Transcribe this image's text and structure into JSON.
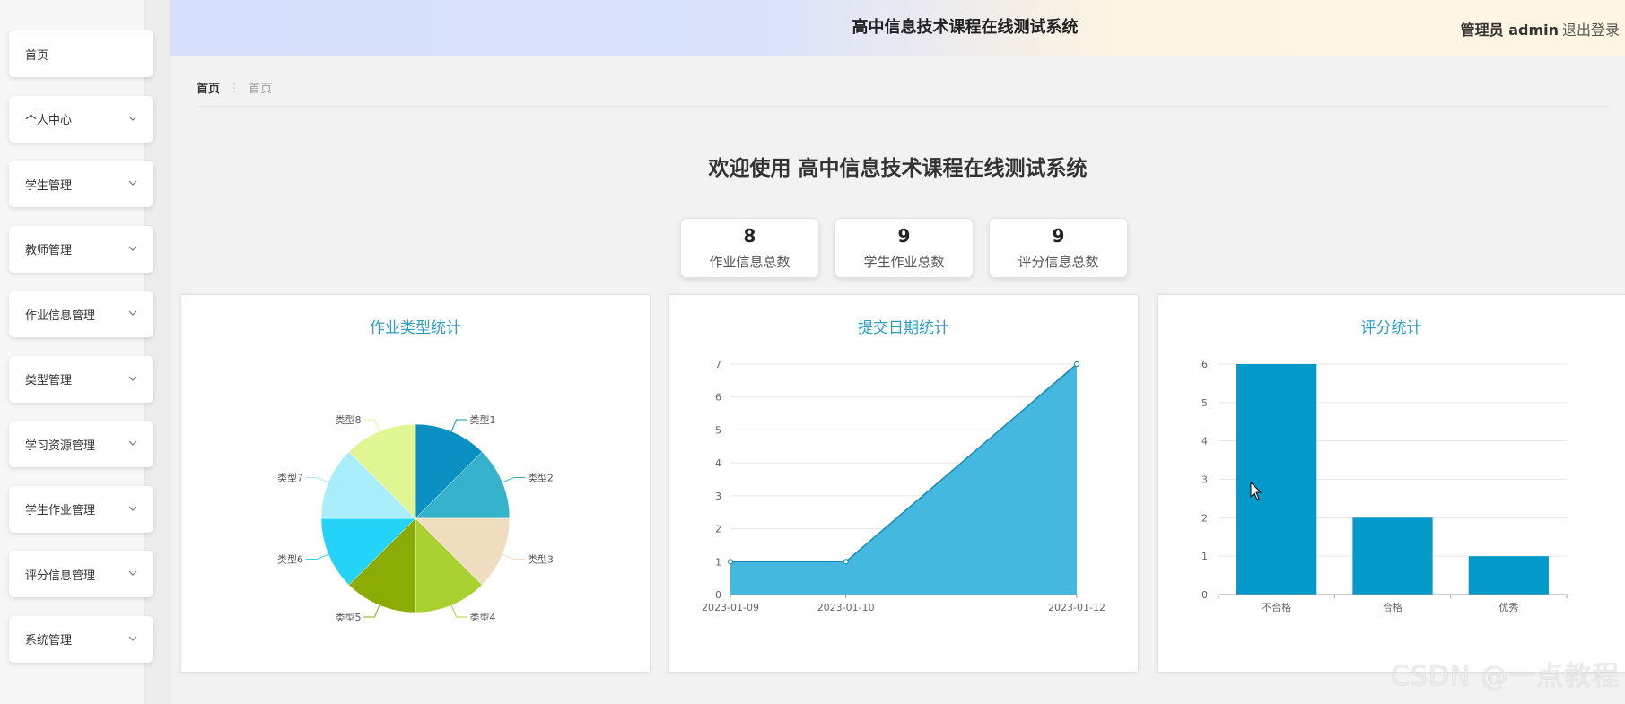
{
  "header": {
    "title": "高中信息技术课程在线测试系统",
    "user": "管理员 admin",
    "logout": "退出登录"
  },
  "sidebar": {
    "items": [
      {
        "label": "首页",
        "has_children": false
      },
      {
        "label": "个人中心",
        "has_children": true
      },
      {
        "label": "学生管理",
        "has_children": true
      },
      {
        "label": "教师管理",
        "has_children": true
      },
      {
        "label": "作业信息管理",
        "has_children": true
      },
      {
        "label": "类型管理",
        "has_children": true
      },
      {
        "label": "学习资源管理",
        "has_children": true
      },
      {
        "label": "学生作业管理",
        "has_children": true
      },
      {
        "label": "评分信息管理",
        "has_children": true
      },
      {
        "label": "系统管理",
        "has_children": true
      }
    ]
  },
  "breadcrumb": {
    "home": "首页",
    "current": "首页"
  },
  "welcome": "欢迎使用 高中信息技术课程在线测试系统",
  "stats": [
    {
      "value": "8",
      "label": "作业信息总数"
    },
    {
      "value": "9",
      "label": "学生作业总数"
    },
    {
      "value": "9",
      "label": "评分信息总数"
    }
  ],
  "watermark": "CSDN @一点教程",
  "colors": {
    "accent": "#2a9ec7",
    "bar": "#0399c9",
    "area": "#3ab4dc"
  },
  "chart_data": [
    {
      "type": "pie",
      "title": "作业类型统计",
      "categories": [
        "类型1",
        "类型2",
        "类型3",
        "类型4",
        "类型5",
        "类型6",
        "类型7",
        "类型8"
      ],
      "values": [
        1,
        1,
        1,
        1,
        1,
        1,
        1,
        1
      ],
      "colors": [
        "#0a8fc3",
        "#35b1cb",
        "#f0dcbf",
        "#a8d031",
        "#8aac04",
        "#24d3f8",
        "#a9ecfa",
        "#e0f693"
      ]
    },
    {
      "type": "area",
      "title": "提交日期统计",
      "x": [
        "2023-01-09",
        "2023-01-10",
        "2023-01-12"
      ],
      "values": [
        1,
        1,
        7
      ],
      "ylim": [
        0,
        7
      ],
      "yticks": [
        0,
        1,
        2,
        3,
        4,
        5,
        6,
        7
      ],
      "grid": true
    },
    {
      "type": "bar",
      "title": "评分统计",
      "categories": [
        "不合格",
        "合格",
        "优秀"
      ],
      "values": [
        6,
        2,
        1
      ],
      "ylim": [
        0,
        6
      ],
      "yticks": [
        0,
        1,
        2,
        3,
        4,
        5,
        6
      ],
      "grid": true
    }
  ]
}
